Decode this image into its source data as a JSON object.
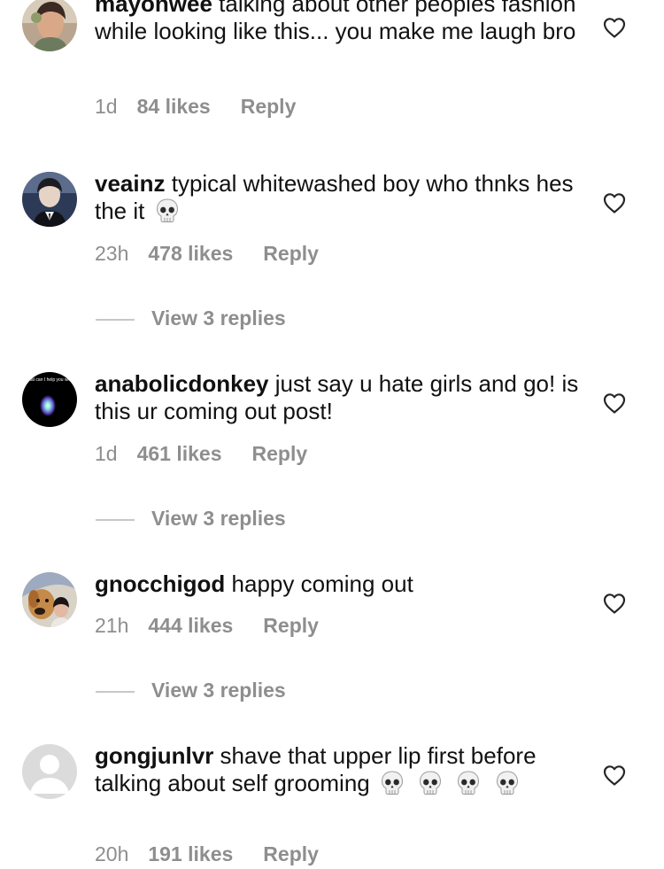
{
  "comments": [
    {
      "username": "mayonwee",
      "text": " talking about other peoples fashion while looking like this... you make me laugh bro",
      "time": "1d",
      "likes": "84 likes",
      "reply": "Reply",
      "avatar_icon": "profile-photo-icon"
    },
    {
      "username": "veainz",
      "text": " typical whitewashed boy who thnks hes the it ",
      "emoji": [
        "skull"
      ],
      "time": "23h",
      "likes": "478 likes",
      "reply": "Reply",
      "view_replies": "View 3 replies",
      "avatar_icon": "profile-photo-icon"
    },
    {
      "username": "anabolicdonkey",
      "text": " just say u hate girls and go! is this ur coming out post!",
      "time": "1d",
      "likes": "461 likes",
      "reply": "Reply",
      "view_replies": "View 3 replies",
      "avatar_icon": "siri-orb-icon",
      "avatar_caption": "What can I help you with?"
    },
    {
      "username": "gnocchigod",
      "text": " happy coming out",
      "time": "21h",
      "likes": "444 likes",
      "reply": "Reply",
      "view_replies": "View 3 replies",
      "avatar_icon": "dog-photo-icon"
    },
    {
      "username": "gongjunlvr",
      "text": " shave that upper lip first before talking about self grooming ",
      "emoji": [
        "skull",
        "skull",
        "skull",
        "skull"
      ],
      "time": "20h",
      "likes": "191 likes",
      "reply": "Reply",
      "avatar_icon": "default-avatar-icon"
    }
  ],
  "colors": {
    "text": "#111111",
    "muted": "#8e8e8e",
    "divider": "#c7c7c7"
  }
}
